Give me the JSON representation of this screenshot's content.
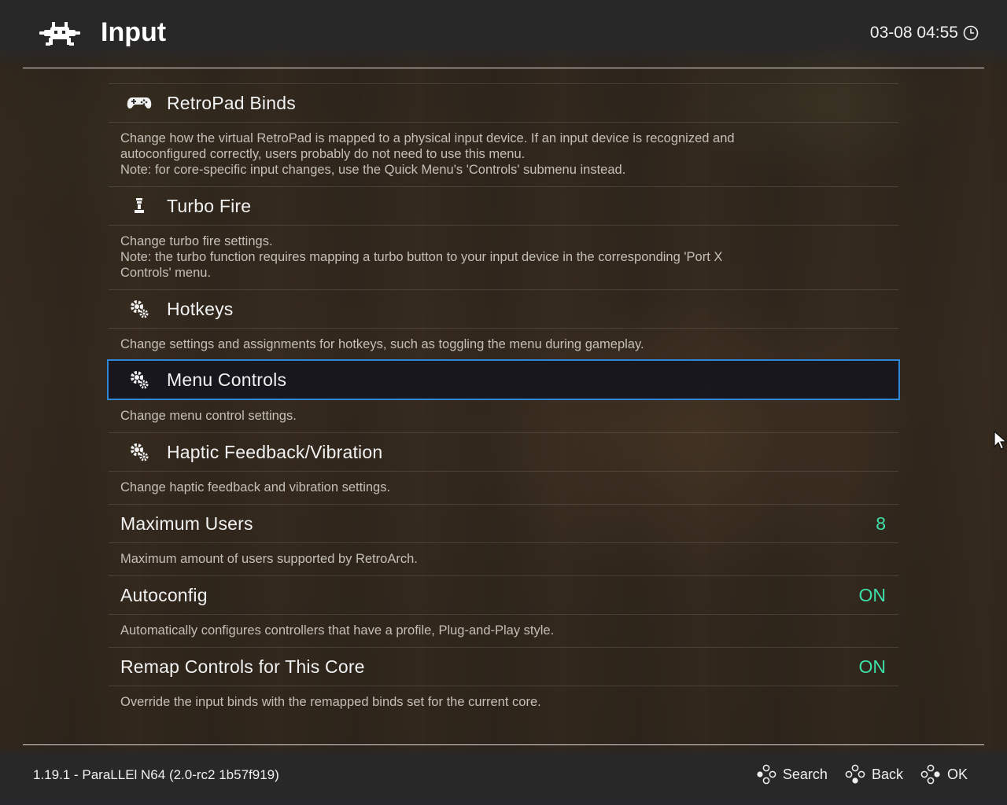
{
  "header": {
    "title": "Input",
    "clock": "03-08 04:55"
  },
  "menu": {
    "items": [
      {
        "label": "RetroPad Binds",
        "icon": "gamepad-icon",
        "desc": [
          "Change how the virtual RetroPad is mapped to a physical input device. If an input device is recognized and",
          "autoconfigured correctly, users probably do not need to use this menu.",
          "Note: for core-specific input changes, use the Quick Menu's 'Controls' submenu instead."
        ]
      },
      {
        "label": "Turbo Fire",
        "icon": "turbo-icon",
        "desc": [
          "Change turbo fire settings.",
          "Note: the turbo function requires mapping a turbo button to your input device in the corresponding 'Port X",
          "Controls' menu."
        ]
      },
      {
        "label": "Hotkeys",
        "icon": "gears-icon",
        "desc": [
          "Change settings and assignments for hotkeys, such as toggling the menu during gameplay."
        ]
      },
      {
        "label": "Menu Controls",
        "icon": "gears-icon",
        "selected": true,
        "desc": [
          "Change menu control settings."
        ]
      },
      {
        "label": "Haptic Feedback/Vibration",
        "icon": "gears-icon",
        "desc": [
          "Change haptic feedback and vibration settings."
        ]
      },
      {
        "label": "Maximum Users",
        "value": "8",
        "desc": [
          "Maximum amount of users supported by RetroArch."
        ]
      },
      {
        "label": "Autoconfig",
        "value": "ON",
        "desc": [
          "Automatically configures controllers that have a profile, Plug-and-Play style."
        ]
      },
      {
        "label": "Remap Controls for This Core",
        "value": "ON",
        "desc": [
          "Override the input binds with the remapped binds set for the current core."
        ]
      }
    ]
  },
  "footer": {
    "version": "1.19.1 - ParaLLEl N64 (2.0-rc2 1b57f919)",
    "hints": [
      {
        "label": "Search",
        "icon": "controller-buttons-icon"
      },
      {
        "label": "Back",
        "icon": "controller-buttons-icon"
      },
      {
        "label": "OK",
        "icon": "controller-buttons-icon"
      }
    ]
  },
  "colors": {
    "accent": "#2f86d6",
    "value": "#3de0a8"
  }
}
